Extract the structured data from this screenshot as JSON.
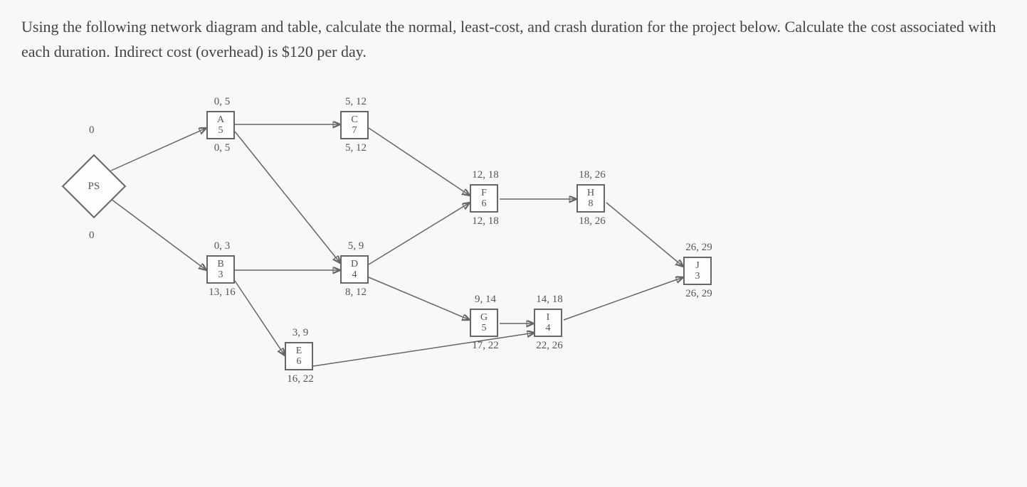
{
  "question": "Using the following network diagram and table, calculate the normal, least-cost, and crash duration for the project below. Calculate the cost associated with each duration. Indirect cost (overhead) is $120 per day.",
  "start": {
    "label": "PS",
    "top_zero": "0",
    "bot_zero": "0"
  },
  "nodes": {
    "A": {
      "label": "A",
      "dur": "5",
      "es_ef": "0, 5",
      "ls_lf": "0, 5"
    },
    "B": {
      "label": "B",
      "dur": "3",
      "es_ef": "0, 3",
      "ls_lf": "13, 16"
    },
    "C": {
      "label": "C",
      "dur": "7",
      "es_ef": "5, 12",
      "ls_lf": "5, 12"
    },
    "D": {
      "label": "D",
      "dur": "4",
      "es_ef": "5, 9",
      "ls_lf": "8, 12"
    },
    "E": {
      "label": "E",
      "dur": "6",
      "es_ef": "3, 9",
      "ls_lf": "16, 22"
    },
    "F": {
      "label": "F",
      "dur": "6",
      "es_ef": "12, 18",
      "ls_lf": "12, 18"
    },
    "G": {
      "label": "G",
      "dur": "5",
      "es_ef": "9, 14",
      "ls_lf": "17, 22"
    },
    "H": {
      "label": "H",
      "dur": "8",
      "es_ef": "18, 26",
      "ls_lf": "18, 26"
    },
    "I": {
      "label": "I",
      "dur": "4",
      "es_ef": "14, 18",
      "ls_lf": "22, 26"
    },
    "J": {
      "label": "J",
      "dur": "3",
      "es_ef": "26, 29",
      "ls_lf": "26, 29"
    }
  },
  "chart_data": {
    "type": "network_diagram",
    "indirect_cost_per_day": 120,
    "activities": [
      {
        "id": "A",
        "duration": 5,
        "ES": 0,
        "EF": 5,
        "LS": 0,
        "LF": 5
      },
      {
        "id": "B",
        "duration": 3,
        "ES": 0,
        "EF": 3,
        "LS": 13,
        "LF": 16
      },
      {
        "id": "C",
        "duration": 7,
        "ES": 5,
        "EF": 12,
        "LS": 5,
        "LF": 12
      },
      {
        "id": "D",
        "duration": 4,
        "ES": 5,
        "EF": 9,
        "LS": 8,
        "LF": 12
      },
      {
        "id": "E",
        "duration": 6,
        "ES": 3,
        "EF": 9,
        "LS": 16,
        "LF": 22
      },
      {
        "id": "F",
        "duration": 6,
        "ES": 12,
        "EF": 18,
        "LS": 12,
        "LF": 18
      },
      {
        "id": "G",
        "duration": 5,
        "ES": 9,
        "EF": 14,
        "LS": 17,
        "LF": 22
      },
      {
        "id": "H",
        "duration": 8,
        "ES": 18,
        "EF": 26,
        "LS": 18,
        "LF": 26
      },
      {
        "id": "I",
        "duration": 4,
        "ES": 14,
        "EF": 18,
        "LS": 22,
        "LF": 26
      },
      {
        "id": "J",
        "duration": 3,
        "ES": 26,
        "EF": 29,
        "LS": 26,
        "LF": 29
      }
    ],
    "edges": [
      [
        "PS",
        "A"
      ],
      [
        "PS",
        "B"
      ],
      [
        "A",
        "C"
      ],
      [
        "A",
        "D"
      ],
      [
        "B",
        "D"
      ],
      [
        "B",
        "E"
      ],
      [
        "C",
        "F"
      ],
      [
        "D",
        "F"
      ],
      [
        "D",
        "G"
      ],
      [
        "E",
        "I"
      ],
      [
        "F",
        "H"
      ],
      [
        "G",
        "I"
      ],
      [
        "H",
        "J"
      ],
      [
        "I",
        "J"
      ]
    ],
    "project_duration_normal": 29
  }
}
